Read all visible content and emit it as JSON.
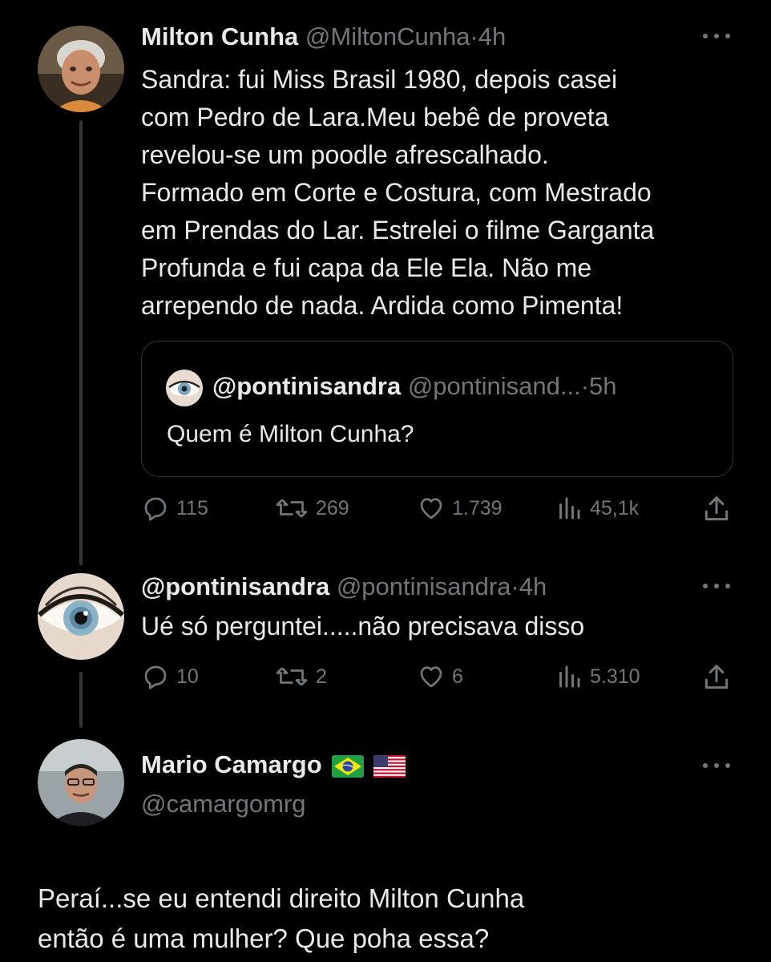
{
  "tweets": [
    {
      "name": "Milton Cunha",
      "handle": "@MiltonCunha",
      "dot": "·",
      "time": "4h",
      "lines": [
        "Sandra: fui Miss Brasil 1980, depois casei",
        "com Pedro de Lara.Meu bebê de proveta",
        "revelou-se um poodle afrescalhado.",
        "Formado em Corte e Costura, com Mestrado",
        "em Prendas do Lar. Estrelei o filme Garganta",
        "Profunda e fui capa da Ele Ela. Não me",
        "arrependo de nada. Ardida como Pimenta!"
      ],
      "quote": {
        "name": "@pontinisandra",
        "handle": "@pontinisand...",
        "dot": "·",
        "time": "5h",
        "text": "Quem é Milton Cunha?"
      },
      "actions": {
        "replies": "115",
        "retweets": "269",
        "likes": "1.739",
        "views": "45,1k"
      }
    },
    {
      "name": "@pontinisandra",
      "handle": "@pontinisandra",
      "dot": "·",
      "time": "4h",
      "text": "Ué só perguntei.....não precisava disso",
      "actions": {
        "replies": "10",
        "retweets": "2",
        "likes": "6",
        "views": "5.310"
      }
    },
    {
      "name": "Mario Camargo",
      "handle": "@camargomrg",
      "flags": [
        "brazil-flag-icon",
        "usa-flag-icon"
      ],
      "lines": [
        "Peraí...se eu entendi direito Milton Cunha",
        "então é uma mulher? Que poha essa?"
      ]
    }
  ],
  "icons": {
    "reply": "reply-icon",
    "retweet": "retweet-icon",
    "like": "heart-icon",
    "views": "views-icon",
    "share": "share-icon",
    "more": "more-icon"
  },
  "colors": {
    "background": "#000000",
    "text": "#e7e9ea",
    "secondary": "#71767b",
    "border": "#2f3336"
  }
}
